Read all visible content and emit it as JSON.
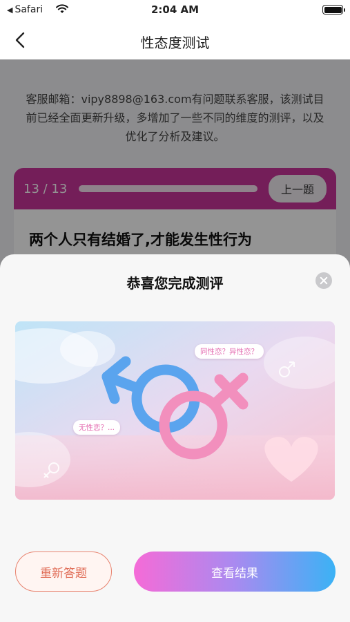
{
  "status_bar": {
    "back_app": "Safari",
    "time": "2:04 AM"
  },
  "nav": {
    "title": "性态度测试"
  },
  "page": {
    "notice": "客服邮箱：vipy8898@163.com有问题联系客服，该测试目前已经全面更新升级，多增加了一些不同的维度的测评，以及优化了分析及建议。",
    "question_card": {
      "counter": "13 / 13",
      "prev_label": "上一题",
      "question": "两个人只有结婚了,才能发生性行为",
      "progress": 1.0
    }
  },
  "sheet": {
    "title": "恭喜您完成测评",
    "illustration": {
      "bubble_1": "同性恋？异性恋？",
      "bubble_2": "无性恋？..."
    },
    "redo_label": "重新答题",
    "result_label": "查看结果"
  },
  "colors": {
    "card_header": "#c8349a",
    "redo_border": "#e8826e",
    "result_gradient_start": "#f56bd7",
    "result_gradient_end": "#3bb2f5",
    "male_symbol": "#5aa4ee",
    "female_symbol": "#f28fbd"
  }
}
